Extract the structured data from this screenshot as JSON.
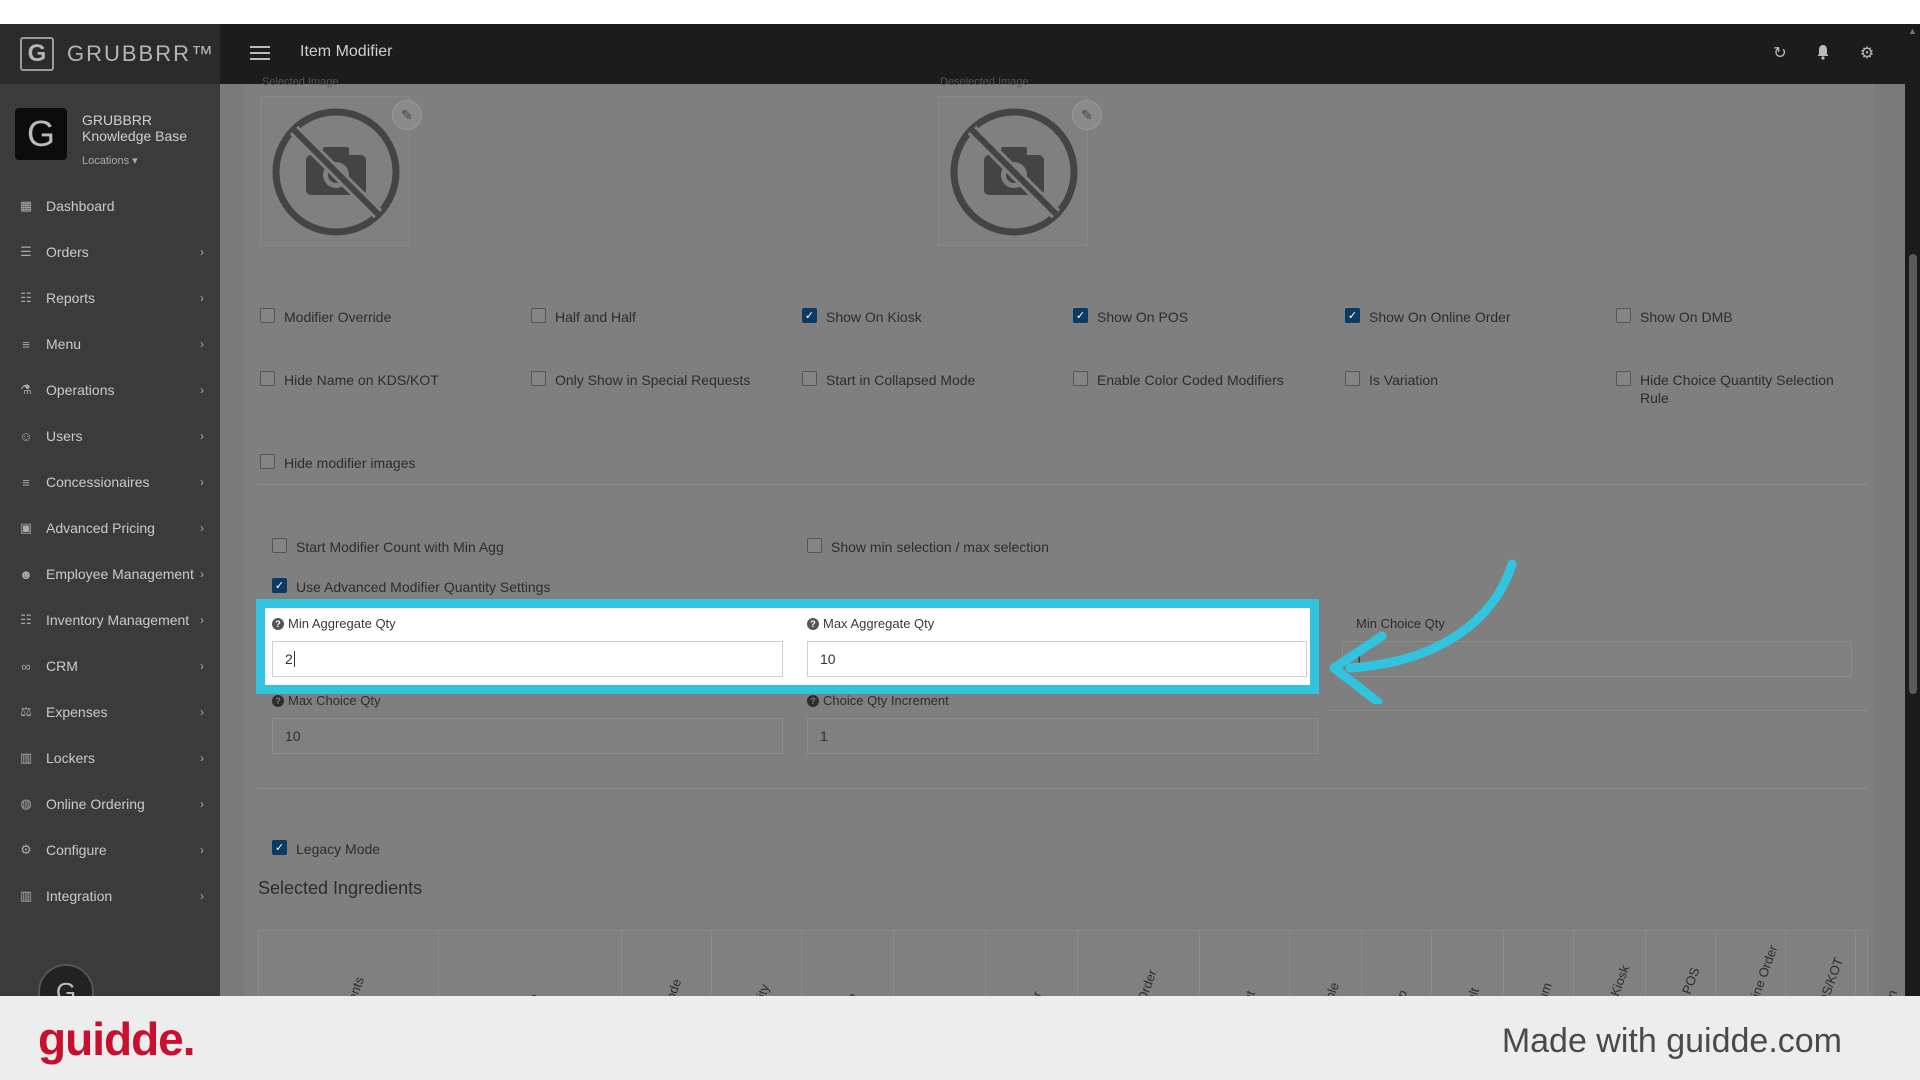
{
  "app": {
    "brand_logo_letter": "G",
    "brand_logo_text": "GRUBBRR™",
    "page_title": "Item Modifier"
  },
  "topbar_icons": [
    "refresh-icon",
    "bell-icon",
    "gear-icon"
  ],
  "sidebar": {
    "org_letter": "G",
    "org_name": "GRUBBRR Knowledge Base",
    "locations_label": "Locations ▾",
    "items": [
      {
        "label": "Dashboard",
        "icon": "dashboard-icon",
        "glyph": "▦",
        "chevron": false
      },
      {
        "label": "Orders",
        "icon": "cart-icon",
        "glyph": "☰",
        "chevron": true
      },
      {
        "label": "Reports",
        "icon": "report-icon",
        "glyph": "☷",
        "chevron": true
      },
      {
        "label": "Menu",
        "icon": "menu-list-icon",
        "glyph": "≡",
        "chevron": true
      },
      {
        "label": "Operations",
        "icon": "flask-icon",
        "glyph": "⚗",
        "chevron": true
      },
      {
        "label": "Users",
        "icon": "users-icon",
        "glyph": "☺",
        "chevron": true
      },
      {
        "label": "Concessionaires",
        "icon": "list-icon",
        "glyph": "≡",
        "chevron": true
      },
      {
        "label": "Advanced Pricing",
        "icon": "money-icon",
        "glyph": "▣",
        "chevron": true
      },
      {
        "label": "Employee Management",
        "icon": "group-icon",
        "glyph": "☻",
        "chevron": true
      },
      {
        "label": "Inventory Management",
        "icon": "sitemap-icon",
        "glyph": "☷",
        "chevron": true
      },
      {
        "label": "CRM",
        "icon": "link-icon",
        "glyph": "∞",
        "chevron": true
      },
      {
        "label": "Expenses",
        "icon": "scale-icon",
        "glyph": "⚖",
        "chevron": true
      },
      {
        "label": "Lockers",
        "icon": "locker-icon",
        "glyph": "▥",
        "chevron": true
      },
      {
        "label": "Online Ordering",
        "icon": "globe-icon",
        "glyph": "◍",
        "chevron": true
      },
      {
        "label": "Configure",
        "icon": "cog-icon",
        "glyph": "⚙",
        "chevron": true
      },
      {
        "label": "Integration",
        "icon": "plug-icon",
        "glyph": "▥",
        "chevron": true
      }
    ],
    "avatar_letter": "G"
  },
  "images": {
    "selected_label": "Selected Image",
    "deselected_label": "Deselected Image"
  },
  "checkboxes_row1": [
    {
      "label": "Modifier Override",
      "checked": false
    },
    {
      "label": "Half and Half",
      "checked": false
    },
    {
      "label": "Show On Kiosk",
      "checked": true
    },
    {
      "label": "Show On POS",
      "checked": true
    },
    {
      "label": "Show On Online Order",
      "checked": true
    },
    {
      "label": "Show On DMB",
      "checked": false
    }
  ],
  "checkboxes_row2": [
    {
      "label": "Hide Name on KDS/KOT",
      "checked": false
    },
    {
      "label": "Only Show in Special Requests",
      "checked": false
    },
    {
      "label": "Start in Collapsed Mode",
      "checked": false
    },
    {
      "label": "Enable Color Coded Modifiers",
      "checked": false
    },
    {
      "label": "Is Variation",
      "checked": false
    },
    {
      "label": "Hide Choice Quantity Selection Rule",
      "checked": false
    }
  ],
  "checkboxes_row3": [
    {
      "label": "Hide modifier images",
      "checked": false
    }
  ],
  "agg_checkboxes": [
    {
      "label": "Start Modifier Count with Min Agg",
      "checked": false
    },
    {
      "label": "Show min selection / max selection",
      "checked": false
    }
  ],
  "advanced_qty": {
    "label": "Use Advanced Modifier Quantity Settings",
    "checked": true
  },
  "fields": {
    "min_agg": {
      "label": "Min Aggregate Qty",
      "value": "2"
    },
    "max_agg": {
      "label": "Max Aggregate Qty",
      "value": "10"
    },
    "min_choice": {
      "label": "Min Choice Qty",
      "value": "1"
    },
    "max_choice": {
      "label": "Max Choice Qty",
      "value": "10"
    },
    "choice_inc": {
      "label": "Choice Qty Increment",
      "value": "1"
    }
  },
  "legacy": {
    "label": "Legacy Mode",
    "checked": true
  },
  "ingredients": {
    "title": "Selected Ingredients",
    "columns": [
      "Ingredients",
      "Type",
      "PLU Code",
      "Quantity",
      "Price",
      "Qty",
      "Order",
      "Display Order",
      "Count",
      "Available",
      "Group",
      "Default",
      "Premium",
      "Show On Kiosk",
      "Show On POS",
      "Show On Online Order",
      "Hide on KDS/KOT",
      "Action"
    ]
  },
  "footer": {
    "logo": "guidde.",
    "made_with": "Made with guidde.com"
  },
  "colors": {
    "highlight": "#32c3de",
    "checkbox_checked": "#0d3a63",
    "guidde_red": "#c8102e"
  }
}
